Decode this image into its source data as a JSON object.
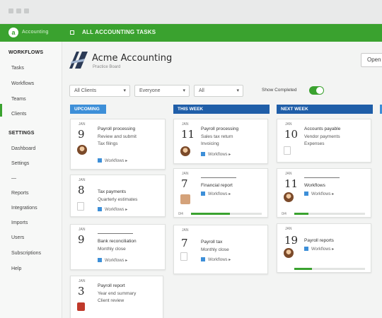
{
  "window": {
    "controls": [
      "dot",
      "dot",
      "dot"
    ]
  },
  "topbar": {
    "brand": "Accounting",
    "company": "ALL ACCOUNTING TASKS"
  },
  "sidebar": {
    "sections": [
      {
        "heading": "WORKFLOWS",
        "items": [
          "Tasks",
          "Workflows",
          "Teams",
          "Clients"
        ]
      },
      {
        "heading": "SETTINGS",
        "items": [
          "Dashboard",
          "Settings",
          "—",
          "Reports",
          "Integrations",
          "Imports",
          "Users",
          "Subscriptions",
          "Help"
        ]
      }
    ]
  },
  "header": {
    "org_name": "Acme Accounting",
    "org_sub": "Practice Board",
    "top_button": "Open"
  },
  "filters": {
    "client": "All Clients",
    "assignee": "Everyone",
    "status": "All",
    "toggle_label": "Show Completed",
    "toggle_on": true
  },
  "columns": [
    {
      "header": "UPCOMING",
      "cards": [
        {
          "mon": "JAN",
          "day": "9",
          "title": "Payroll processing",
          "line2": "Review and submit",
          "line3": "Tax filings",
          "meta": "Workflows ▸"
        },
        {
          "mon": "JAN",
          "day": "8",
          "title": "Tax payments",
          "line2": "Quarterly estimates",
          "line3": "",
          "meta": "Workflows ▸"
        },
        {
          "mon": "JAN",
          "day": "9",
          "title": "Bank reconciliation",
          "line2": "Monthly close",
          "line3": "",
          "meta": "Workflows ▸"
        },
        {
          "mon": "JAN",
          "day": "3",
          "title": "Payroll report",
          "line2": "Year end summary",
          "line3": "Client review",
          "meta": ""
        }
      ]
    },
    {
      "header": "THIS WEEK",
      "cards": [
        {
          "mon": "JAN",
          "day": "11",
          "title": "Payroll processing",
          "line2": "Sales tax return",
          "line3": "Invoicing",
          "meta": "Workflows ▸"
        },
        {
          "mon": "JAN",
          "day": "7",
          "title": "Financial report",
          "line2": "Workflows ▸",
          "line3": "",
          "meta": "",
          "progress": 0.55,
          "pnum": "0/4"
        },
        {
          "mon": "JAN",
          "day": "7",
          "title": "Payroll tax",
          "line2": "Monthly close",
          "line3": "",
          "meta": "Workflows ▸"
        }
      ]
    },
    {
      "header": "NEXT WEEK",
      "cards": [
        {
          "mon": "JAN",
          "day": "10",
          "title": "Accounts payable",
          "line2": "Vendor payments",
          "line3": "Expenses",
          "meta": ""
        },
        {
          "mon": "JAN",
          "day": "11",
          "title": "Workflows",
          "line2": "Workflows ▸",
          "line3": "",
          "meta": "",
          "progress": 0.2,
          "pnum": "0/4"
        },
        {
          "mon": "JAN",
          "day": "19",
          "title": "Payroll reports",
          "line2": "Workflows ▸",
          "line3": "",
          "meta": "",
          "progress": 0.25,
          "pnum": ""
        }
      ]
    }
  ],
  "colors": {
    "brand_green": "#3aa22f",
    "col_light": "#3d8fd8",
    "col_dark": "#1f5ea8"
  }
}
